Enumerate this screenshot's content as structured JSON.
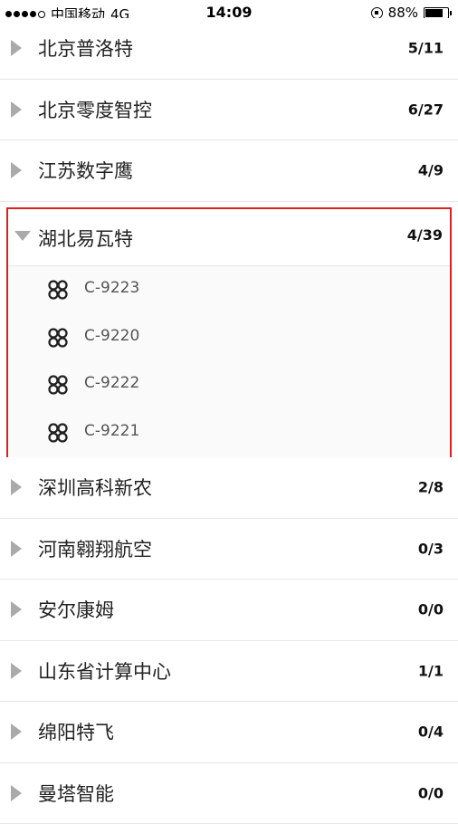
{
  "status_bar": {
    "carrier": "中国移动",
    "network": "4G",
    "time": "14:09",
    "battery": "88%",
    "battery_level": 0.88
  },
  "rows_top": [
    {
      "name": "北京普洛特",
      "count": "5/11"
    },
    {
      "name": "北京零度智控",
      "count": "6/27"
    },
    {
      "name": "江苏数字鹰",
      "count": "4/9"
    }
  ],
  "expanded_group": {
    "name": "湖北易瓦特",
    "count": "4/39",
    "devices": [
      "C-9223",
      "C-9220",
      "C-9222",
      "C-9221"
    ]
  },
  "rows_bottom": [
    {
      "name": "深圳高科新农",
      "count": "2/8"
    },
    {
      "name": "河南翱翔航空",
      "count": "0/3"
    },
    {
      "name": "安尔康姆",
      "count": "0/0"
    },
    {
      "name": "山东省计算中心",
      "count": "1/1"
    },
    {
      "name": "绵阳特飞",
      "count": "0/4"
    },
    {
      "name": "曼塔智能",
      "count": "0/0"
    }
  ],
  "icons": {
    "row_collapsed": "triangle-right-icon",
    "row_expanded": "triangle-down-icon",
    "device": "drone-icon"
  },
  "colors": {
    "highlight_border": "#e02020",
    "triangle": "#aaaaaa"
  }
}
